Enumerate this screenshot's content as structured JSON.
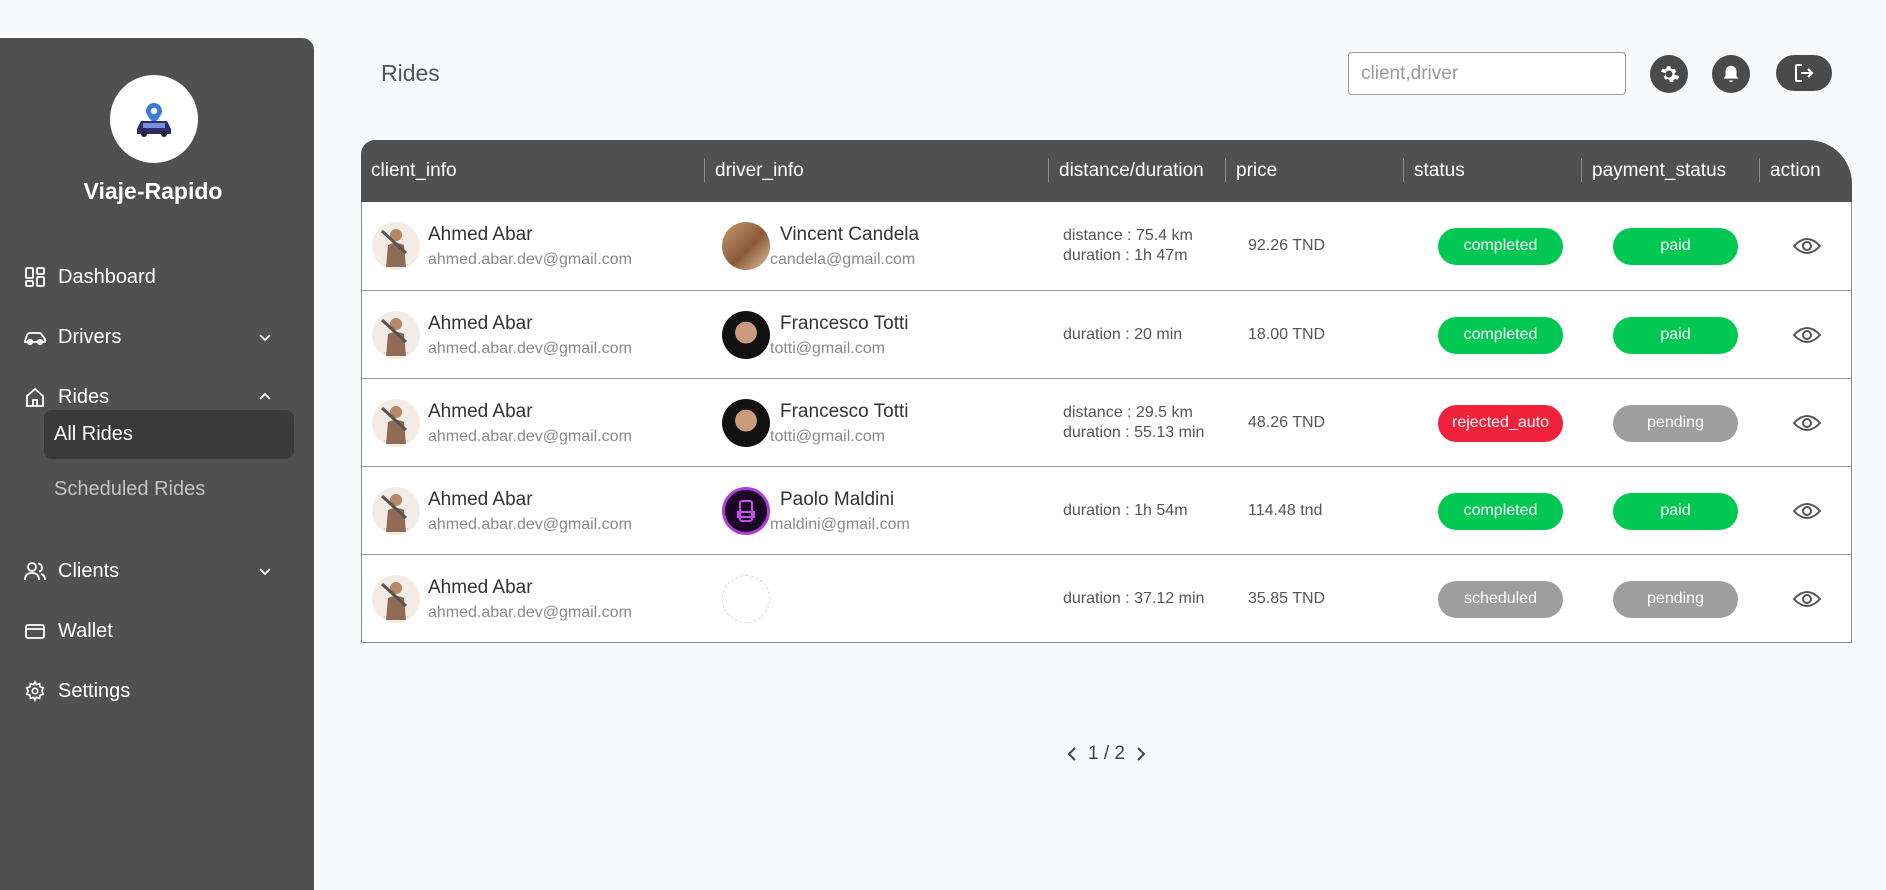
{
  "brand": {
    "name": "Viaje-Rapido",
    "logo_icon": "car-location-icon"
  },
  "sidebar": {
    "items": [
      {
        "label": "Dashboard",
        "icon": "dashboard-icon"
      },
      {
        "label": "Drivers",
        "icon": "car-icon"
      },
      {
        "label": "Rides",
        "icon": "home-icon"
      },
      {
        "label": "Clients",
        "icon": "users-icon"
      },
      {
        "label": "Wallet",
        "icon": "wallet-icon"
      },
      {
        "label": "Settings",
        "icon": "gear-icon"
      }
    ],
    "rides_sub": [
      {
        "label": "All Rides",
        "active": true
      },
      {
        "label": "Scheduled Rides",
        "active": false
      }
    ]
  },
  "header": {
    "title": "Rides",
    "search_placeholder": "client,driver"
  },
  "table": {
    "columns": [
      "client_info",
      "driver_info",
      "distance/duration",
      "price",
      "status",
      "payment_status",
      "action"
    ],
    "rows": [
      {
        "client_name": "Ahmed Abar",
        "client_email": "ahmed.abar.dev@gmail.com",
        "driver_name": "Vincent Candela",
        "driver_email": "candela@gmail.com",
        "distance": "distance : 75.4 km",
        "duration": "duration : 1h 47m",
        "price": "92.26 TND",
        "status": "completed",
        "payment_status": "paid"
      },
      {
        "client_name": "Ahmed Abar",
        "client_email": "ahmed.abar.dev@gmail.com",
        "driver_name": "Francesco Totti",
        "driver_email": "totti@gmail.com",
        "distance": "",
        "duration": "duration : 20 min",
        "price": "18.00 TND",
        "status": "completed",
        "payment_status": "paid"
      },
      {
        "client_name": "Ahmed Abar",
        "client_email": "ahmed.abar.dev@gmail.com",
        "driver_name": "Francesco Totti",
        "driver_email": "totti@gmail.com",
        "distance": "distance : 29.5 km",
        "duration": "duration : 55.13 min",
        "price": "48.26 TND",
        "status": "rejected_auto",
        "payment_status": "pending"
      },
      {
        "client_name": "Ahmed Abar",
        "client_email": "ahmed.abar.dev@gmail.com",
        "driver_name": "Paolo Maldini",
        "driver_email": "maldini@gmail.com",
        "distance": "",
        "duration": "duration : 1h 54m",
        "price": "114.48 tnd",
        "status": "completed",
        "payment_status": "paid"
      },
      {
        "client_name": "Ahmed Abar",
        "client_email": "ahmed.abar.dev@gmail.com",
        "driver_name": "",
        "driver_email": "",
        "distance": "",
        "duration": "duration : 37.12 min",
        "price": "35.85 TND",
        "status": "scheduled",
        "payment_status": "pending"
      }
    ]
  },
  "pagination": {
    "text": "1 / 2"
  },
  "colors": {
    "sidebar_bg": "#505050",
    "completed": "#00c853",
    "paid": "#00c853",
    "rejected": "#f0213a",
    "neutral": "#9e9e9e"
  }
}
